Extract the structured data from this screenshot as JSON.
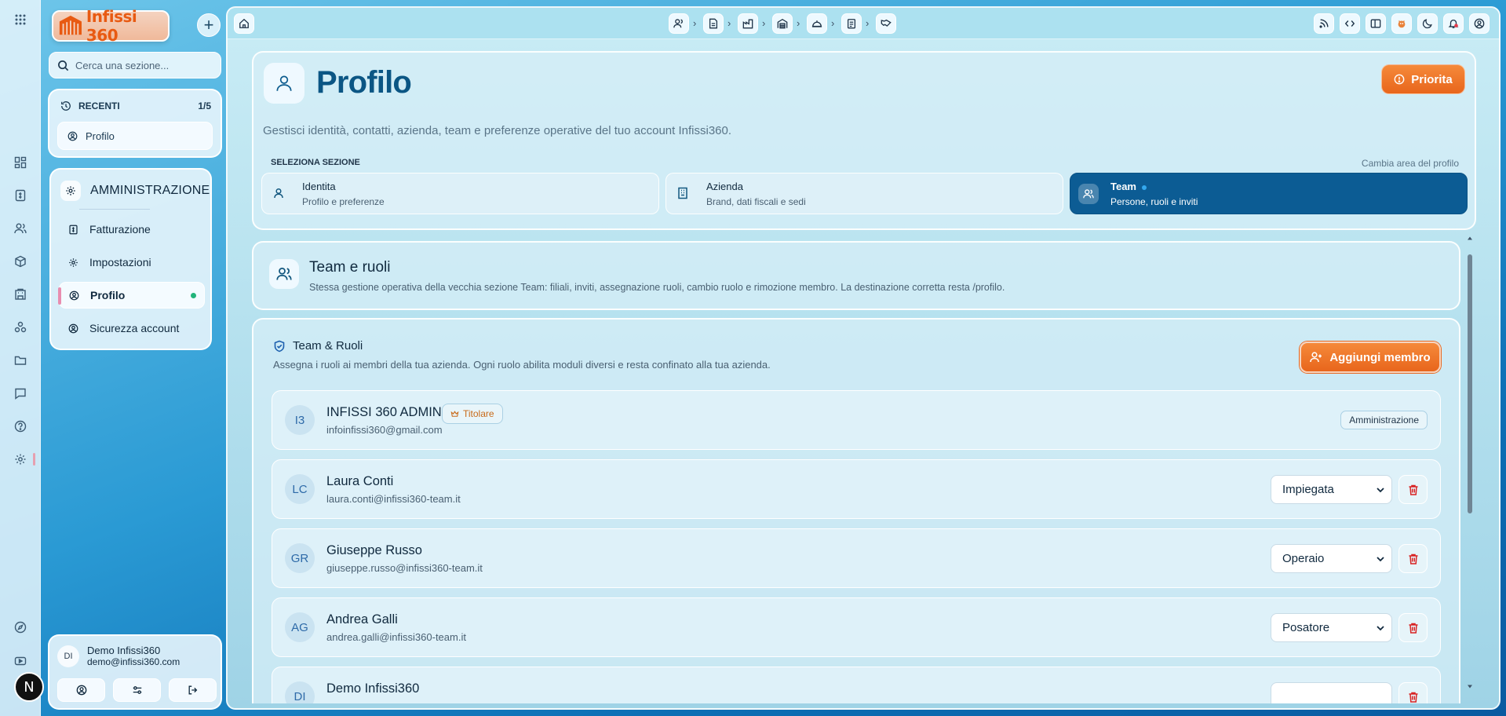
{
  "app": {
    "logo_text": "Infissi 360"
  },
  "search": {
    "placeholder": "Cerca una sezione..."
  },
  "recent": {
    "title": "RECENTI",
    "count": "1/5",
    "items": [
      {
        "label": "Profilo"
      }
    ]
  },
  "admin": {
    "title": "AMMINISTRAZIONE",
    "items": [
      {
        "label": "Fatturazione"
      },
      {
        "label": "Impostazioni"
      },
      {
        "label": "Profilo"
      },
      {
        "label": "Sicurezza account"
      }
    ]
  },
  "user": {
    "initials": "DI",
    "name": "Demo Infissi360",
    "email": "demo@infissi360.com"
  },
  "rail_badge": "N",
  "page": {
    "title": "Profilo",
    "description": "Gestisci identità, contatti, azienda, team e preferenze operative del tuo account Infissi360.",
    "priority_label": "Priorita",
    "select_label": "SELEZIONA SEZIONE",
    "select_hint": "Cambia area del profilo",
    "sections": [
      {
        "title": "Identita",
        "subtitle": "Profilo e preferenze"
      },
      {
        "title": "Azienda",
        "subtitle": "Brand, dati fiscali e sedi"
      },
      {
        "title": "Team",
        "subtitle": "Persone, ruoli e inviti"
      }
    ]
  },
  "team_section": {
    "title": "Team e ruoli",
    "description": "Stessa gestione operativa della vecchia sezione Team: filiali, inviti, assegnazione ruoli, cambio ruolo e rimozione membro. La destinazione corretta resta /profilo."
  },
  "team_card": {
    "title": "Team & Ruoli",
    "description": "Assegna i ruoli ai membri della tua azienda. Ogni ruolo abilita moduli diversi e resta confinato alla tua azienda.",
    "add_label": "Aggiungi membro"
  },
  "members": [
    {
      "initials": "I3",
      "name": "INFISSI 360 ADMIN",
      "email": "infoinfissi360@gmail.com",
      "badge": "Titolare",
      "role": "Amministrazione"
    },
    {
      "initials": "LC",
      "name": "Laura Conti",
      "email": "laura.conti@infissi360-team.it",
      "role": "Impiegata"
    },
    {
      "initials": "GR",
      "name": "Giuseppe Russo",
      "email": "giuseppe.russo@infissi360-team.it",
      "role": "Operaio"
    },
    {
      "initials": "AG",
      "name": "Andrea Galli",
      "email": "andrea.galli@infissi360-team.it",
      "role": "Posatore"
    },
    {
      "initials": "DI",
      "name": "Demo Infissi360"
    }
  ],
  "colors": {
    "accent": "#0c5c94",
    "orange": "#e8661c",
    "danger": "#d82222",
    "online": "#22b47a"
  }
}
